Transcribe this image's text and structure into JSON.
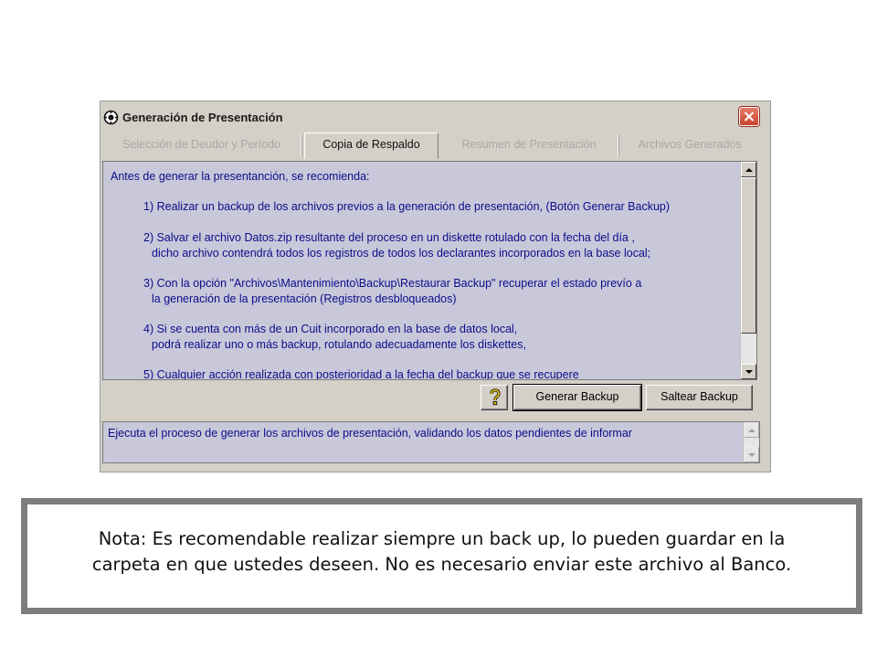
{
  "window": {
    "title": "Generación de Presentación",
    "icon": "gear-app-icon",
    "close_icon": "close-icon"
  },
  "tabs": [
    {
      "label": "Selección de Deudor y Período",
      "active": false
    },
    {
      "label": "Copia de Respaldo",
      "active": true
    },
    {
      "label": "Resumen de  Presentación",
      "active": false
    },
    {
      "label": "Archivos Generados",
      "active": false
    }
  ],
  "content": {
    "lines": [
      "Antes de generar la presentanción, se recomienda:",
      "1) Realizar un backup de los archivos previos a la generación de presentación, (Botón Generar Backup)",
      "2) Salvar el archivo Datos.zip resultante del proceso en un diskette rotulado con la fecha del día ,",
      "dicho archivo contendrá todos los registros de todos los declarantes incorporados en la base local;",
      "3) Con la opción \"Archivos\\Mantenimiento\\Backup\\Restaurar Backup\" recuperar el estado prevío a",
      "la generación de la presentación (Registros desbloqueados)",
      "4) Si se cuenta con más de un Cuit incorporado en la base de datos local,",
      "podrá realizar uno o más backup, rotulando adecuadamente los diskettes,",
      "5) Cualquier acción realizada con posterioridad a la fecha del backup que se recupere"
    ]
  },
  "buttons": {
    "help_icon": "help-question-icon",
    "generate": "Generar Backup",
    "skip": "Saltear Backup"
  },
  "status": {
    "text": "Ejecuta el proceso de generar los archivos de presentación, validando los datos pendientes de informar"
  },
  "note": {
    "line1": "Nota: Es recomendable realizar siempre un back up, lo pueden guardar en la",
    "line2": "carpeta en que ustedes deseen. No es necesario enviar este archivo al Banco."
  },
  "colors": {
    "window_bg": "#d4d0c8",
    "panel_bg": "#c8c8da",
    "text_blue": "#0c0c8a",
    "close_red": "#c8422e",
    "note_border": "#7d7d7d"
  }
}
